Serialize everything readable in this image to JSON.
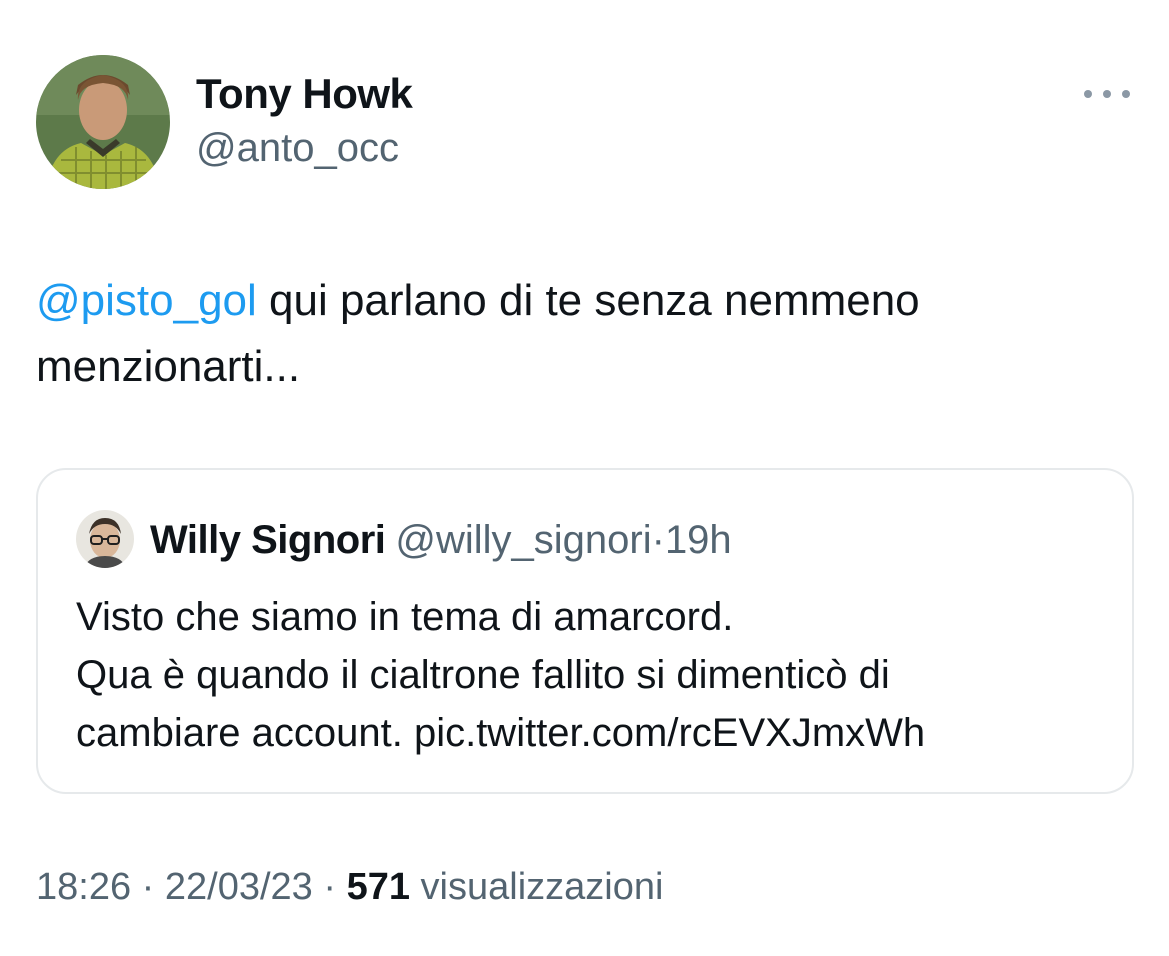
{
  "author": {
    "display_name": "Tony Howk",
    "handle": "@anto_occ"
  },
  "tweet": {
    "mention": "@pisto_gol",
    "text": " qui parlano di te senza nemmeno menzionarti..."
  },
  "quoted_tweet": {
    "display_name": "Willy Signori",
    "handle": "@willy_signori",
    "separator": "·",
    "time": "19h",
    "line1": "Visto che siamo in tema di amarcord.",
    "line2": "Qua è quando il cialtrone fallito si dimenticò di",
    "line3": "cambiare account. pic.twitter.com/rcEVXJmxWh"
  },
  "footer": {
    "time": "18:26",
    "sep1": " · ",
    "date": "22/03/23",
    "sep2": " · ",
    "views_count": "571",
    "views_label": " visualizzazioni"
  },
  "icons": {
    "more": "more-horizontal-icon"
  },
  "colors": {
    "link": "#1d9bf0",
    "secondary_text": "#536471",
    "primary_text": "#0f1419",
    "card_border": "#e6e9eb"
  }
}
